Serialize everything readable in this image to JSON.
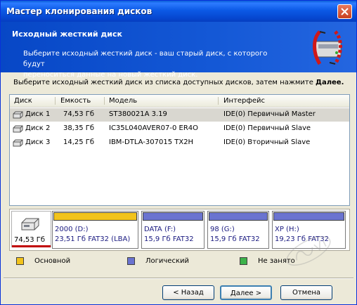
{
  "window": {
    "title": "Мастер клонирования дисков"
  },
  "header": {
    "title": "Исходный жесткий диск",
    "desc_line1": "Выберите исходный жесткий диск - ваш старый диск, с которого будут",
    "desc_line2": "переноситься данные на новый жесткий диск."
  },
  "instruction": {
    "text": "Выберите исходный жесткий диск из списка доступных дисков, затем нажмите",
    "bold": "Далее."
  },
  "list": {
    "columns": [
      "Диск",
      "Емкость",
      "Модель",
      "Интерфейс"
    ],
    "rows": [
      {
        "disk": "Диск 1",
        "capacity": "74,53 Гб",
        "model": "ST380021A 3.19",
        "iface": "IDE(0) Первичный Master",
        "selected": true
      },
      {
        "disk": "Диск 2",
        "capacity": "38,35 Гб",
        "model": "IC35L040AVER07-0 ER4O",
        "iface": "IDE(0) Первичный Slave",
        "selected": false
      },
      {
        "disk": "Диск 3",
        "capacity": "14,25 Гб",
        "model": "IBM-DTLA-307015 TX2H",
        "iface": "IDE(0) Вторичный Slave",
        "selected": false
      }
    ]
  },
  "partition_map": {
    "disk_label": "74,53 Гб",
    "partitions": [
      {
        "name": "2000 (D:)",
        "info": "23,51 Гб  FAT32 (LBA)",
        "type": "primary"
      },
      {
        "name": "DATA (F:)",
        "info": "15,9 Гб  FAT32",
        "type": "logical"
      },
      {
        "name": "98 (G:)",
        "info": "15,9 Гб  FAT32",
        "type": "logical"
      },
      {
        "name": "XP (H:)",
        "info": "19,23 Гб  FAT32",
        "type": "logical"
      }
    ]
  },
  "legend": {
    "primary": "Основной",
    "logical": "Логический",
    "free": "Не занято"
  },
  "colors": {
    "primary": "#f2c31c",
    "logical": "#6a73d0",
    "free": "#3cb24a",
    "header_blue": "#0747c6"
  },
  "buttons": {
    "back": "< Назад",
    "next": "Далее >",
    "cancel": "Отмена"
  },
  "watermark": {
    "text": "Sovet"
  }
}
